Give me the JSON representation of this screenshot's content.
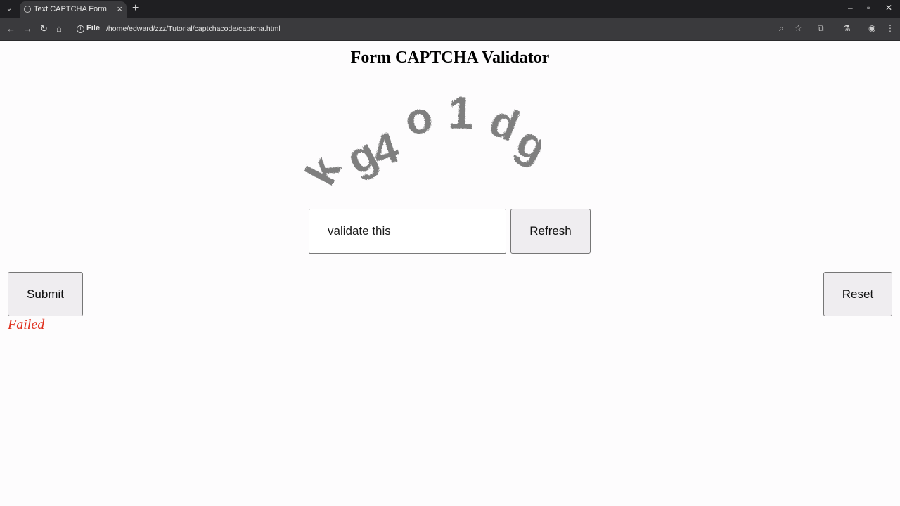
{
  "browser": {
    "tab_title": "Text CAPTCHA Form",
    "new_tab": "+",
    "tab_close": "×",
    "file_chip": "File",
    "url": "/home/edward/zzz/Tutorial/captchacode/captcha.html",
    "window_controls": [
      "–",
      "▫",
      "✕"
    ]
  },
  "page": {
    "title": "Form CAPTCHA Validator",
    "captcha": {
      "text": "kg4o1dg",
      "glyphs": [
        "k",
        "g",
        "4",
        "o",
        "1",
        "d",
        "g"
      ],
      "color": "#7f7f7f"
    },
    "input": {
      "value": "validate this"
    },
    "refresh_label": "Refresh",
    "submit_label": "Submit",
    "reset_label": "Reset",
    "status": {
      "text": "Failed",
      "color": "#e0301e"
    }
  }
}
